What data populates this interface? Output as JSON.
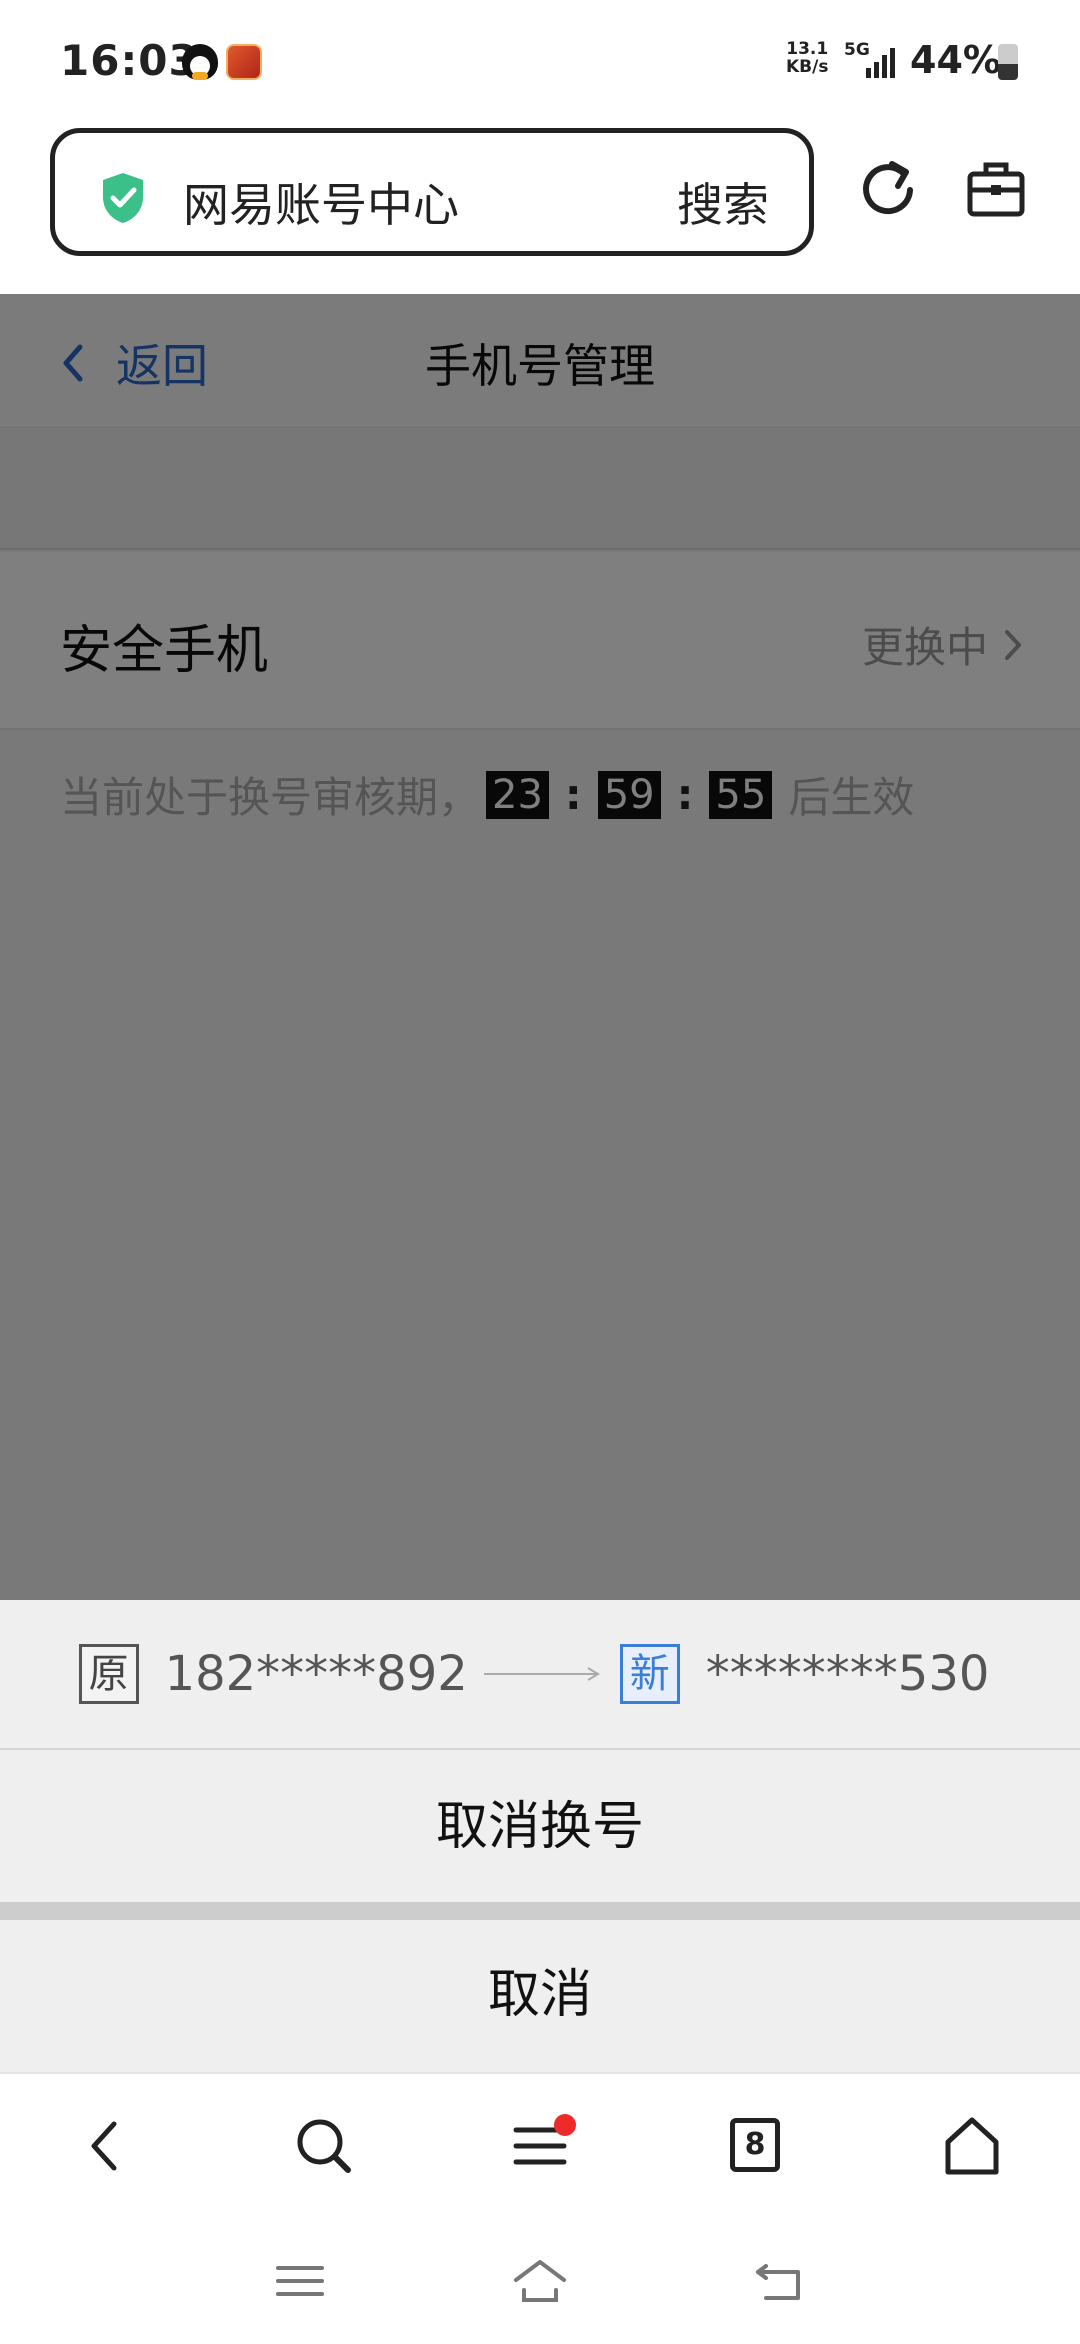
{
  "status_bar": {
    "time": "16:03",
    "net_speed_value": "13.1",
    "net_speed_unit": "KB/s",
    "network": "5G",
    "battery": "44%",
    "battery_level": 0.44
  },
  "browser": {
    "url_title": "网易账号中心",
    "search_label": "搜索",
    "secure_color": "#3cc08a"
  },
  "page": {
    "back_label": "返回",
    "title": "手机号管理",
    "phone_row": {
      "label": "安全手机",
      "status": "更换中"
    },
    "notice": {
      "prefix": "当前处于换号审核期，",
      "hours": "23",
      "minutes": "59",
      "seconds": "55",
      "separator": ":",
      "suffix": "后生效"
    }
  },
  "sheet": {
    "old_tag": "原",
    "old_number": "182*****892",
    "new_tag": "新",
    "new_number": "********530",
    "cancel_change_label": "取消换号",
    "cancel_label": "取消"
  },
  "bottom_nav": {
    "tab_count": "8"
  },
  "colors": {
    "link_blue": "#2b68c9",
    "badge_red": "#ee2a2a"
  }
}
